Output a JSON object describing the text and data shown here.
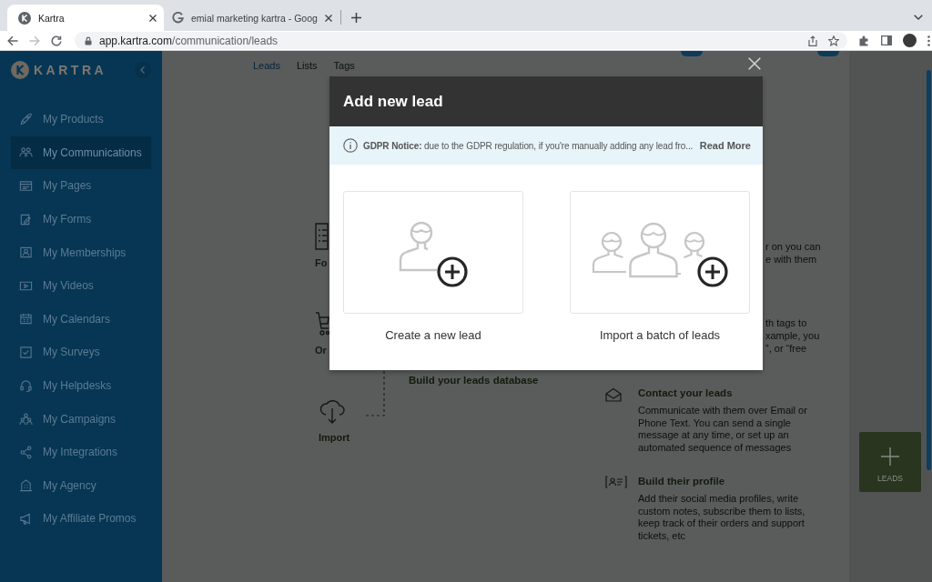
{
  "browser": {
    "tabs": [
      {
        "title": "Kartra",
        "selected": true
      },
      {
        "title": "emial marketing kartra - Goog",
        "selected": false
      }
    ],
    "url": {
      "host": "app.kartra.com",
      "path": "/communication/leads"
    }
  },
  "sidebar": {
    "logo": "KARTRA",
    "items": [
      {
        "label": "My Products",
        "selected": false
      },
      {
        "label": "My Communications",
        "selected": true
      },
      {
        "label": "My Pages",
        "selected": false
      },
      {
        "label": "My Forms",
        "selected": false
      },
      {
        "label": "My Memberships",
        "selected": false
      },
      {
        "label": "My Videos",
        "selected": false
      },
      {
        "label": "My Calendars",
        "selected": false
      },
      {
        "label": "My Surveys",
        "selected": false
      },
      {
        "label": "My Helpdesks",
        "selected": false
      },
      {
        "label": "My Campaigns",
        "selected": false
      },
      {
        "label": "My Integrations",
        "selected": false
      },
      {
        "label": "My Agency",
        "selected": false
      },
      {
        "label": "My Affiliate Promos",
        "selected": false
      }
    ]
  },
  "page_tabs": [
    {
      "label": "Leads",
      "selected": true
    },
    {
      "label": "Lists",
      "selected": false
    },
    {
      "label": "Tags",
      "selected": false
    }
  ],
  "steps": [
    {
      "label": "Fo"
    },
    {
      "label": "Or"
    },
    {
      "label": "Import"
    }
  ],
  "section_heading": "Build your leads database",
  "covered_paragraphs": [
    {
      "lines": [
        "r on you can",
        "e with them"
      ]
    },
    {
      "lines": [
        "th tags to",
        "xample, you",
        "”, or “free"
      ]
    }
  ],
  "features": [
    {
      "title": "Contact your leads",
      "text": "Communicate with them over Email or Phone Text. You can send a single message at any time, or set up an automated sequence of messages"
    },
    {
      "title": "Build their profile",
      "text": "Add their social media profiles, write custom notes, subscribe them to lists, keep track of their orders and support tickets, etc"
    }
  ],
  "leads_button": {
    "label": "LEADS"
  },
  "modal": {
    "title": "Add new lead",
    "notice": "**GDPR Notice:** due to the GDPR regulation, if you're manually adding any lead fro...",
    "read_more": "Read More",
    "options": [
      {
        "kind": "single",
        "label": "Create a new lead"
      },
      {
        "kind": "batch",
        "label": "Import a batch of leads"
      }
    ]
  }
}
